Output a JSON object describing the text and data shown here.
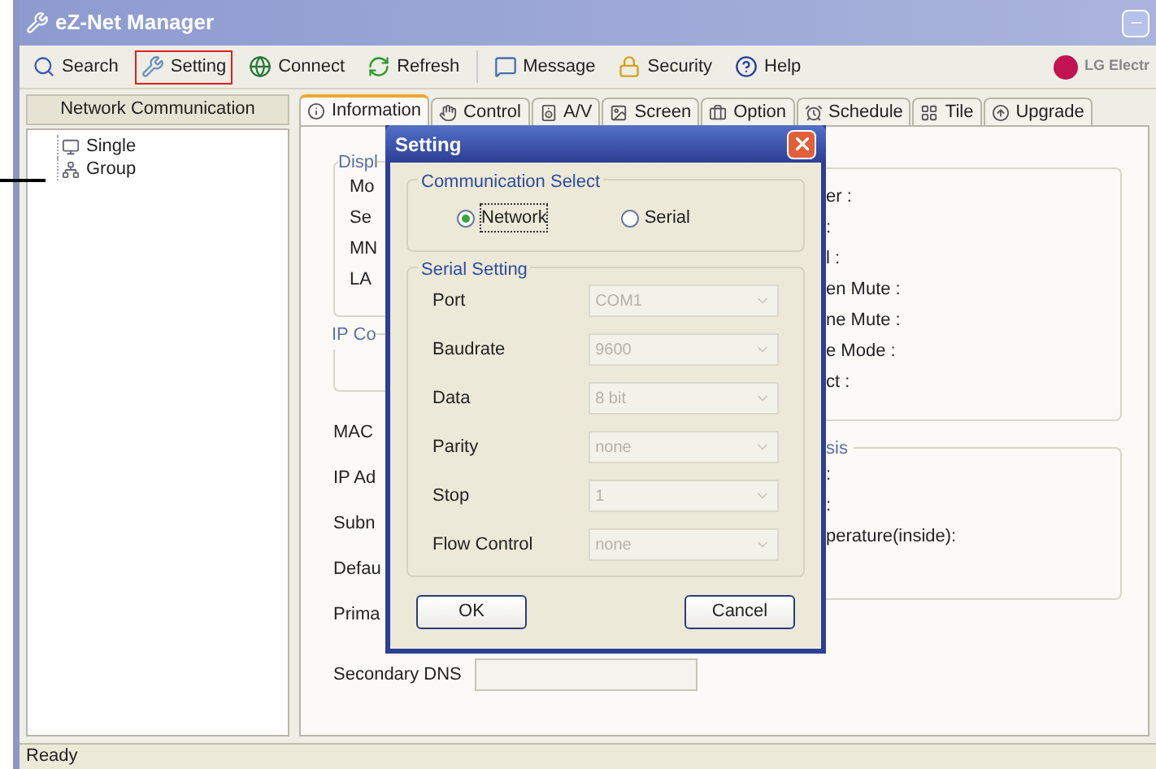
{
  "window": {
    "title": "eZ-Net Manager"
  },
  "toolbar": [
    {
      "label": "Search",
      "selected": false
    },
    {
      "label": "Setting",
      "selected": true
    },
    {
      "label": "Connect",
      "selected": false
    },
    {
      "label": "Refresh",
      "selected": false
    },
    {
      "label": "Message",
      "selected": false
    },
    {
      "label": "Security",
      "selected": false
    },
    {
      "label": "Help",
      "selected": false
    }
  ],
  "brand": "LG Electr",
  "sidebar": {
    "title": "Network Communication",
    "items": [
      {
        "label": "Single"
      },
      {
        "label": "Group"
      }
    ]
  },
  "tabs": [
    {
      "label": "Information",
      "selected": true
    },
    {
      "label": "Control",
      "selected": false
    },
    {
      "label": "A/V",
      "selected": false
    },
    {
      "label": "Screen",
      "selected": false
    },
    {
      "label": "Option",
      "selected": false
    },
    {
      "label": "Schedule",
      "selected": false
    },
    {
      "label": "Tile",
      "selected": false
    },
    {
      "label": "Upgrade",
      "selected": false
    }
  ],
  "info": {
    "display_group": {
      "title": "Displ",
      "labels": [
        "Mo",
        "Se",
        "MN",
        "LA"
      ]
    },
    "ip_group": {
      "title": "IP Co"
    },
    "fields": [
      "MAC",
      "IP Ad",
      "Subn",
      "Defau",
      "Prima"
    ],
    "secondary_dns": {
      "label": "Secondary DNS"
    },
    "status_labels": [
      "er :",
      ":",
      "l :",
      "en Mute :",
      "ne Mute :",
      "e Mode :",
      "ct :"
    ],
    "diagnosis": {
      "title": "sis",
      "labels": [
        ":",
        ":",
        "perature(inside):"
      ]
    }
  },
  "dialog": {
    "title": "Setting",
    "communication": {
      "title": "Communication Select",
      "options": [
        {
          "label": "Network",
          "selected": true
        },
        {
          "label": "Serial",
          "selected": false
        }
      ]
    },
    "serial": {
      "title": "Serial Setting",
      "rows": [
        {
          "label": "Port",
          "value": "COM1",
          "disabled": true
        },
        {
          "label": "Baudrate",
          "value": "9600",
          "disabled": true
        },
        {
          "label": "Data",
          "value": "8 bit",
          "disabled": true
        },
        {
          "label": "Parity",
          "value": "none",
          "disabled": true
        },
        {
          "label": "Stop",
          "value": "1",
          "disabled": true
        },
        {
          "label": "Flow Control",
          "value": "none",
          "disabled": true
        }
      ]
    },
    "buttons": [
      "OK",
      "Cancel"
    ]
  },
  "status_bar": "Ready"
}
